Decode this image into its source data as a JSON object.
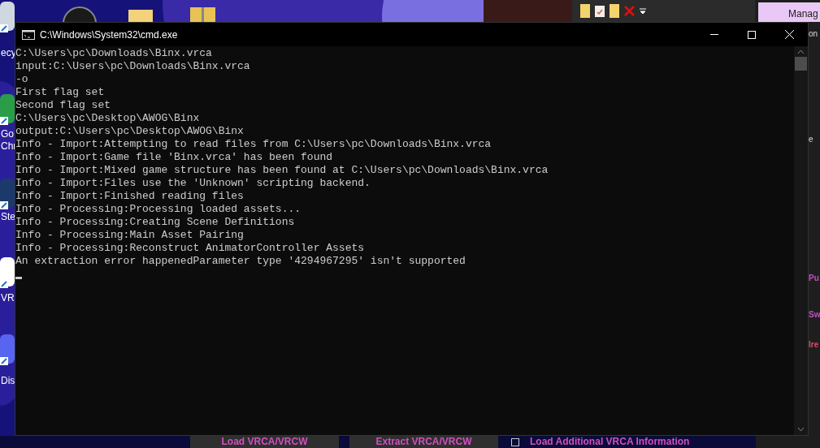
{
  "desktop": {
    "icons": [
      {
        "lines": [
          "ecy"
        ],
        "kind": "bin"
      },
      {
        "lines": [
          "Go",
          "Chr"
        ],
        "kind": "chrome"
      },
      {
        "lines": [
          "Ste"
        ],
        "kind": "steam"
      },
      {
        "lines": [
          "VR"
        ],
        "kind": "vr"
      },
      {
        "lines": [
          "Dis"
        ],
        "kind": "discord"
      }
    ]
  },
  "background_app": {
    "top_button": "Manag",
    "fragments": [
      "on",
      "e",
      "Pu",
      "Sw",
      "lre"
    ],
    "bottom_buttons": [
      "Load VRCA/VRCW",
      "Extract VRCA/VRCW"
    ],
    "checkbox": {
      "label": "Load Additional VRCA Information",
      "checked": false
    }
  },
  "window": {
    "title": "C:\\Windows\\System32\\cmd.exe",
    "lines": [
      "C:\\Users\\pc\\Downloads\\Binx.vrca",
      "input:C:\\Users\\pc\\Downloads\\Binx.vrca",
      "-o",
      "First flag set",
      "Second flag set",
      "C:\\Users\\pc\\Desktop\\AWOG\\Binx",
      "output:C:\\Users\\pc\\Desktop\\AWOG\\Binx",
      "Info - Import:Attempting to read files from C:\\Users\\pc\\Downloads\\Binx.vrca",
      "Info - Import:Game file 'Binx.vrca' has been found",
      "Info - Import:Mixed game structure has been found at C:\\Users\\pc\\Downloads\\Binx.vrca",
      "Info - Import:Files use the 'Unknown' scripting backend.",
      "Info - Import:Finished reading files",
      "Info - Processing:Processing loaded assets...",
      "Info - Processing:Creating Scene Definitions",
      "Info - Processing:Main Asset Pairing",
      "Info - Processing:Reconstruct AnimatorController Assets",
      "An extraction error happenedParameter type '4294967295' isn't supported"
    ]
  }
}
